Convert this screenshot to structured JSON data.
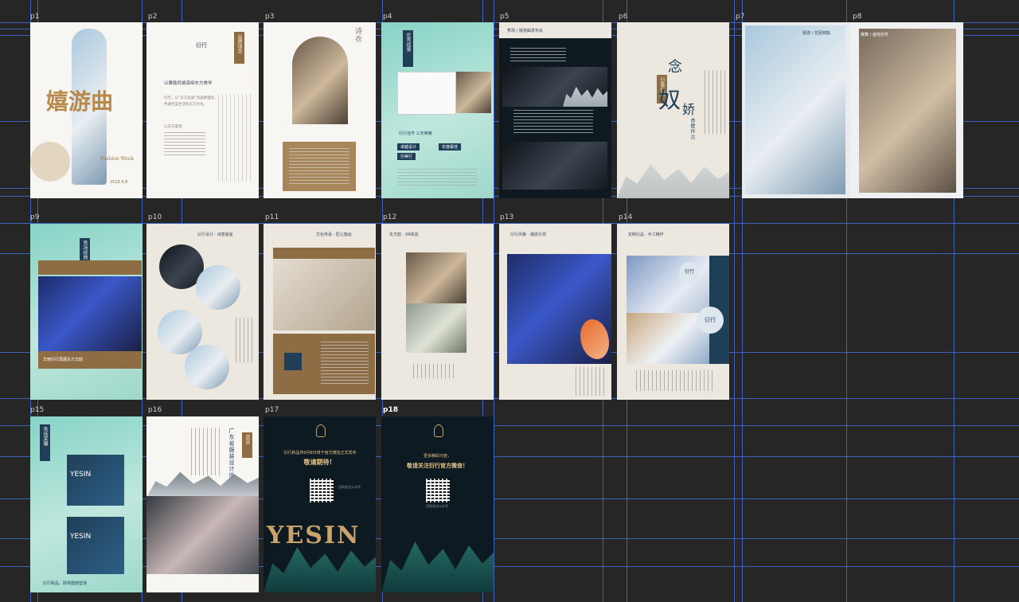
{
  "artboards": {
    "p1": {
      "label": "p1",
      "title": "嬉游曲",
      "brand": "Fashion Week",
      "footer": "2018.9.8"
    },
    "p2": {
      "label": "p2",
      "tag": "品牌理念",
      "logo": "衍行",
      "headline": "以雅致风格演绎东方美学",
      "body": "衍行，以“东方品质”为品牌理念，传递佳美生活的东方文化。",
      "sub": "以东方意境"
    },
    "p3": {
      "label": "p3",
      "script": "诗衣"
    },
    "p4": {
      "label": "p4",
      "tag": "优秀成果",
      "caption": "衍行佳作 三天荣耀",
      "btn1": "卓越设计",
      "btn2": "年度最佳",
      "btn3": "衍美行"
    },
    "p5": {
      "label": "p5",
      "header": "秀场 / 嬉游曲发布会"
    },
    "p6": {
      "label": "p6",
      "tag": "衍集信念",
      "title1": "念",
      "title2": "奴",
      "title3": "娇",
      "sub": "赤壁怀古"
    },
    "p7": {
      "label": "p7",
      "caption": "嬉游 / 花团锦簇"
    },
    "p8": {
      "label": "p8",
      "caption": "蝶舞 / 遍地芬芳"
    },
    "p9": {
      "label": "p9",
      "tag": "秀场经典",
      "caption": "华丽衍行再展东方华韵"
    },
    "p10": {
      "label": "p10",
      "header": "衍行设计 · 诗意氤氲"
    },
    "p11": {
      "label": "p11",
      "header": "文化传承 · 匠心独运"
    },
    "p12": {
      "label": "p12",
      "header": "东方韵 · VR体验"
    },
    "p13": {
      "label": "p13",
      "header": "衍行风格 · 潮流引领"
    },
    "p14": {
      "label": "p14",
      "header": "定制衍品 · 手工精作",
      "seal1": "衍行",
      "seal2": "衍行"
    },
    "p15": {
      "label": "p15",
      "tag": "秀场荣耀",
      "brand1": "YESIN",
      "brand2": "YESIN",
      "footer": "衍行新品，即将震撼登场"
    },
    "p16": {
      "label": "p16",
      "tag": "荣获",
      "title": "广东省服装设计协会"
    },
    "p17": {
      "label": "p17",
      "announce": "衍行新品将9月8日将于官方微信正式发布",
      "cta": "敬请期待！",
      "qr_caption": "扫码关注公众号",
      "logo": "YESIN"
    },
    "p18": {
      "label": "p18",
      "announce": "更多精彩内容，",
      "cta": "敬请关注衍行官方微信！",
      "qr_caption": "扫码关注公众号"
    }
  },
  "selected_artboard": "p18",
  "colors": {
    "canvas": "#262626",
    "guide": "#3f6fd8",
    "paper": "#ece8e0",
    "navy": "#1f3f59",
    "gold": "#e6c58a"
  }
}
